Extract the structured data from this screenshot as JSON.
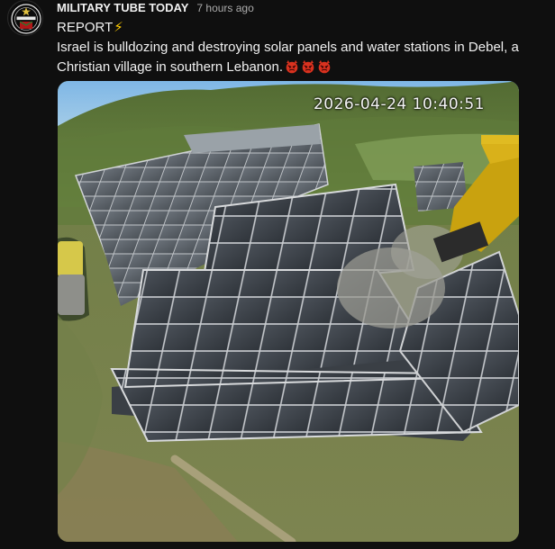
{
  "post": {
    "channel_name": "MILITARY TUBE TODAY",
    "timestamp": "7 hours ago",
    "avatar_text": "MILITARY TUBE TODAY",
    "headline": "REPORT",
    "headline_emoji": "⚡",
    "body": "Israel is bulldozing and destroying solar panels and water stations in Debel, a Christian village in southern Lebanon.",
    "trailing_emoji_count": 3,
    "trailing_emoji_icon": "angry-devil-face-icon"
  },
  "media": {
    "type": "video-still",
    "overlay_timestamp": "2026-04-24 10:40:51"
  },
  "colors": {
    "background": "#0f0f0f",
    "text": "#f1f1f1",
    "muted": "#aaaaaa",
    "bolt": "#ffcc00",
    "devil": "#d9321f"
  }
}
